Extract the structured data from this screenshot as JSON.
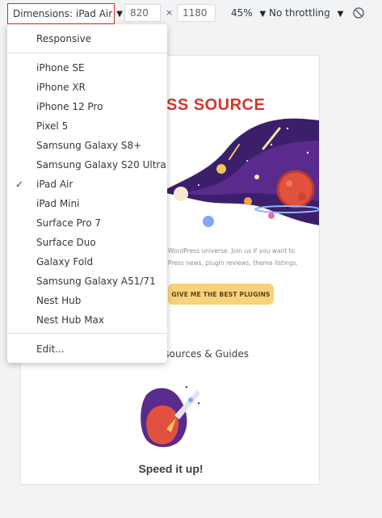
{
  "toolbar": {
    "dimensions_label": "Dimensions: iPad Air",
    "width_value": "820",
    "times_symbol": "×",
    "height_value": "1180",
    "zoom_label": "45%",
    "throttle_label": "No throttling",
    "caret": "▼"
  },
  "menu": {
    "items": [
      {
        "label": "Responsive"
      },
      {
        "label": "iPhone SE"
      },
      {
        "label": "iPhone XR"
      },
      {
        "label": "iPhone 12 Pro"
      },
      {
        "label": "Pixel 5"
      },
      {
        "label": "Samsung Galaxy S8+"
      },
      {
        "label": "Samsung Galaxy S20 Ultra"
      },
      {
        "label": "iPad Air",
        "selected": true
      },
      {
        "label": "iPad Mini"
      },
      {
        "label": "Surface Pro 7"
      },
      {
        "label": "Surface Duo"
      },
      {
        "label": "Galaxy Fold"
      },
      {
        "label": "Samsung Galaxy A51/71"
      },
      {
        "label": "Nest Hub"
      },
      {
        "label": "Nest Hub Max"
      },
      {
        "label": "Edit..."
      }
    ],
    "check_glyph": "✓"
  },
  "page": {
    "hero_title": "SS SOURCE",
    "hero_text_line1": "WordPress universe. Join us if you want to",
    "hero_text_line2": "Press news, plugin reviews, theme listings,",
    "cta_label": "GIVE ME THE BEST PLUGINS",
    "section_title": "esources & Guides",
    "speed_title": "Speed it up!"
  },
  "colors": {
    "accent_red": "#d93025",
    "brand_red": "#d6352c",
    "cta_yellow": "#f9d178"
  },
  "icons": {
    "rotate": "rotate-icon",
    "check": "check-icon",
    "dropdown": "chevron-down-icon"
  }
}
